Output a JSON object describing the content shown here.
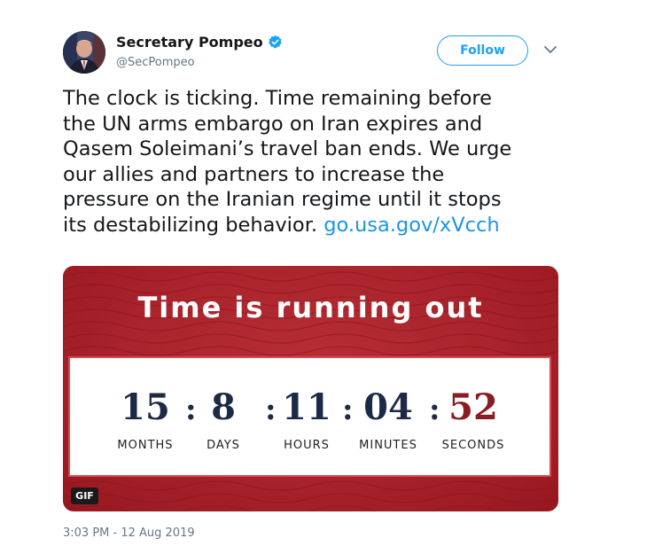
{
  "author": {
    "name": "Secretary Pompeo",
    "handle": "@SecPompeo",
    "verified": true,
    "avatar_icon": "profile-photo"
  },
  "follow_label": "Follow",
  "menu_icon": "chevron-down-icon",
  "tweet": {
    "text_line1": "The clock is ticking. Time remaining before",
    "text_line2": "the UN arms embargo on Iran expires and",
    "text_line3": "Qasem Soleimani’s travel ban ends. We urge",
    "text_line4": "our allies and partners to increase the",
    "text_line5": "pressure on the Iranian regime until it stops",
    "text_line6": "its destabilizing behavior.",
    "link": "go.usa.gov/xVcch",
    "timestamp": "3:03 PM - 12 Aug 2019"
  },
  "card": {
    "title": "Time is running out",
    "months_value": "15",
    "months_label": "MONTHS",
    "days_value": "8",
    "days_label": "DAYS",
    "hours_value": "11",
    "hours_label": "HOURS",
    "minutes_value": "04",
    "minutes_label": "MINUTES",
    "seconds_value": "52",
    "seconds_label": "SECONDS",
    "separator": ":",
    "gif_badge": "GIF",
    "colors": {
      "background": "#a8232b",
      "number": "#1d2a45",
      "seconds_number": "#8b1c22"
    }
  },
  "colors": {
    "link": "#1b95e0",
    "follow": "#1da1f2",
    "muted": "#657786"
  }
}
